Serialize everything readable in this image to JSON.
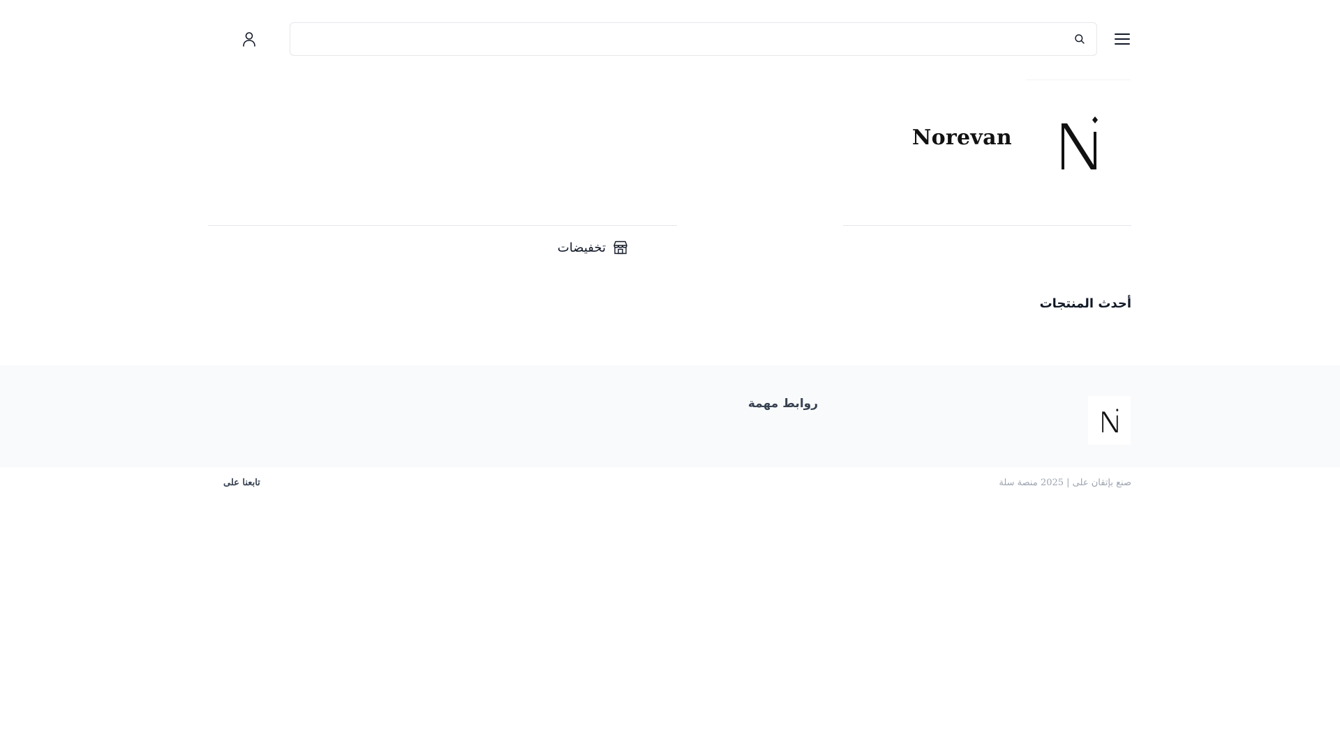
{
  "header": {
    "menu_icon": "hamburger-menu-icon",
    "search": {
      "placeholder": "",
      "value": "",
      "icon": "search-icon"
    },
    "account_icon": "user-icon"
  },
  "brand": {
    "name": "Norevan",
    "logo_icon": "norevan-n-logo"
  },
  "nav": {
    "items": [
      {
        "label": "تخفيضات",
        "icon": "store-icon"
      }
    ]
  },
  "sections": {
    "latest_products_title": "أحدث المنتجات"
  },
  "footer": {
    "links_title": "روابط مهمة",
    "copyright": "صنع بإتقان على | 2025 منصة سلة",
    "follow_us": "تابعنا على"
  },
  "colors": {
    "text_primary": "#111827",
    "text_muted": "#9ca3af",
    "footer_bg": "#f9fafb",
    "border": "#e5e7eb"
  }
}
